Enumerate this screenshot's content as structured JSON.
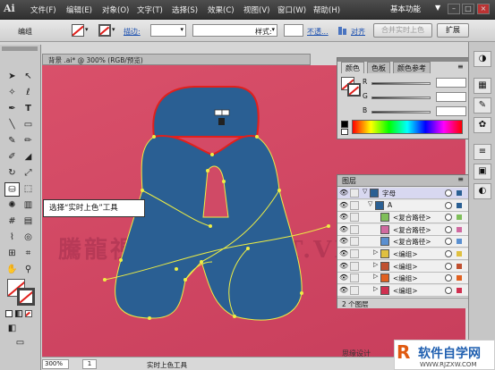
{
  "menubar": {
    "logo": "Ai",
    "items": [
      "文件(F)",
      "编辑(E)",
      "对象(O)",
      "文字(T)",
      "选择(S)",
      "效果(C)",
      "视图(V)",
      "窗口(W)",
      "帮助(H)"
    ],
    "workspace": "基本功能",
    "workspace_arrow": "▼",
    "win_min": "–",
    "win_max": "□",
    "win_close": "×"
  },
  "controlbar": {
    "selection_label": "编组",
    "stroke_label": "描边:",
    "style_label": "样式:",
    "opacity_link": "不透...",
    "align_link": "对齐",
    "expand_selection_btn": "合并实时上色",
    "expand_btn": "扩展"
  },
  "document": {
    "tab_title": "背景 .ai* @ 300% (RGB/预览)",
    "watermark": "騰龍視覺 WWW.TT.VIN",
    "zoom": "300%",
    "page": "1",
    "status_tool": "实时上色工具",
    "footer_text": "思缘设计"
  },
  "tooltip": {
    "text": "选择“实时上色”工具"
  },
  "color_panel": {
    "tabs": [
      "颜色",
      "色板",
      "颜色参考"
    ],
    "channels": [
      "R",
      "G",
      "B"
    ],
    "colors": {
      "accent": "#e0201c",
      "shape": "#2a5f93",
      "canvas": "#d04a66"
    }
  },
  "layers_panel": {
    "title": "图层",
    "rows": [
      {
        "name": "字母",
        "color": "#2a5f93",
        "expand": "▽"
      },
      {
        "name": "A",
        "color": "#2a5f93",
        "expand": "▽"
      },
      {
        "name": "<复合路径>",
        "color": "#7fbf5a",
        "expand": ""
      },
      {
        "name": "<复合路径>",
        "color": "#d06aa0",
        "expand": ""
      },
      {
        "name": "<复合路径>",
        "color": "#5a8fd0",
        "expand": ""
      },
      {
        "name": "<编组>",
        "color": "#e0c040",
        "expand": "▷"
      },
      {
        "name": "<编组>",
        "color": "#c05030",
        "expand": "▷"
      },
      {
        "name": "<编组>",
        "color": "#e06020",
        "expand": "▷"
      },
      {
        "name": "<编组>",
        "color": "#d03050",
        "expand": "▷"
      }
    ],
    "footer": "2 个图层"
  },
  "brand": {
    "name": "软件自学网",
    "url": "WWW.RJZXW.COM"
  }
}
